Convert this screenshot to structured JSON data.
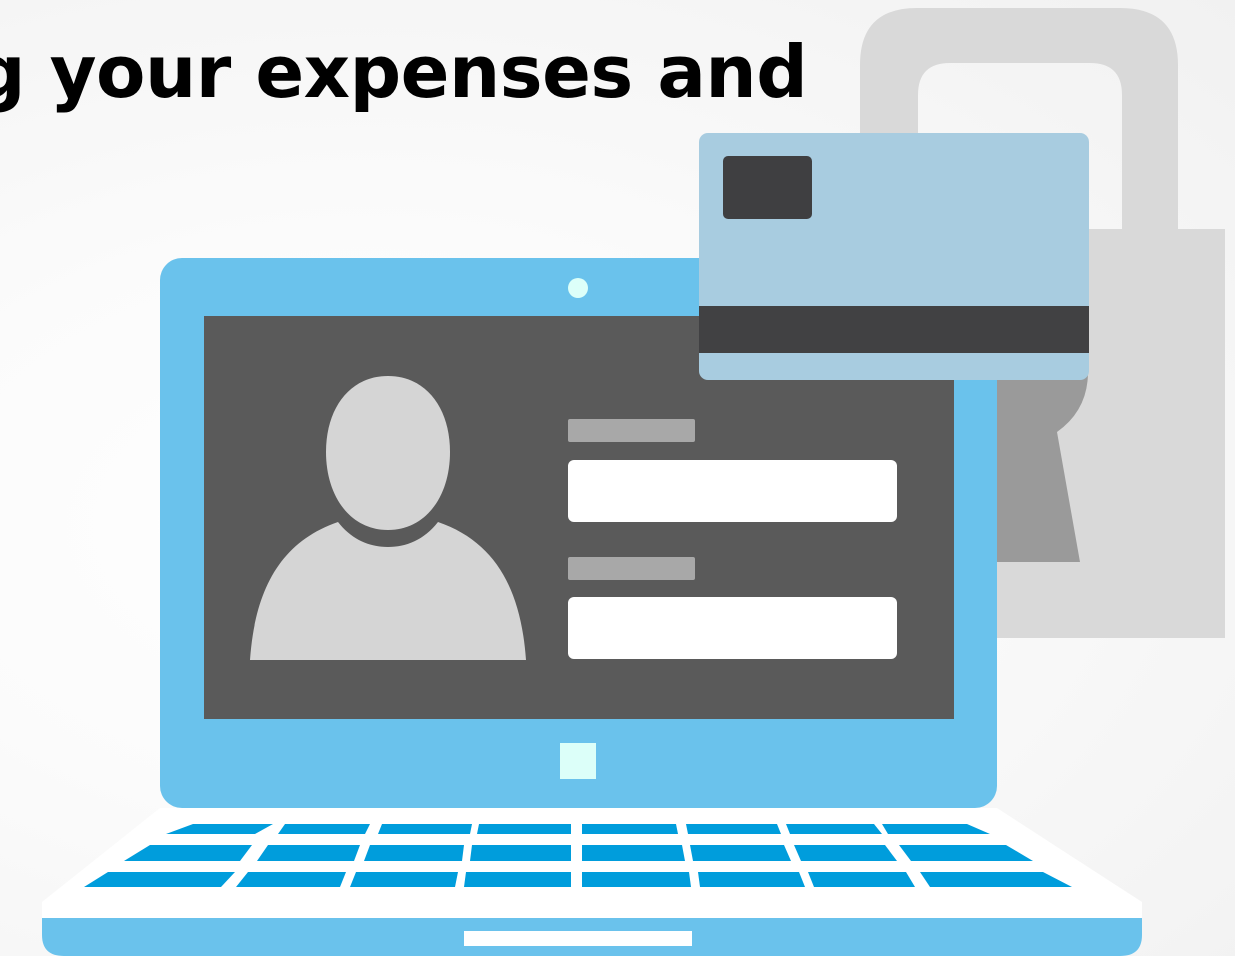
{
  "headline": {
    "text": "g your expenses and"
  },
  "illustration": {
    "icons": [
      "padlock-icon",
      "credit-card-icon",
      "laptop-icon",
      "user-silhouette-icon",
      "login-form-icon",
      "keyboard-icon"
    ],
    "colors": {
      "laptop_body": "#6ac2ec",
      "screen": "#5a5a5a",
      "silhouette": "#d5d5d5",
      "form_label": "#a8a8a8",
      "form_field": "#ffffff",
      "card_body": "#a8cce0",
      "card_chip": "#3f3f41",
      "card_stripe": "#414143",
      "padlock": "#d9d9d9",
      "padlock_keyhole": "#9a9a9a",
      "key_blue": "#009ddc",
      "button_light": "#dcfff9"
    }
  }
}
